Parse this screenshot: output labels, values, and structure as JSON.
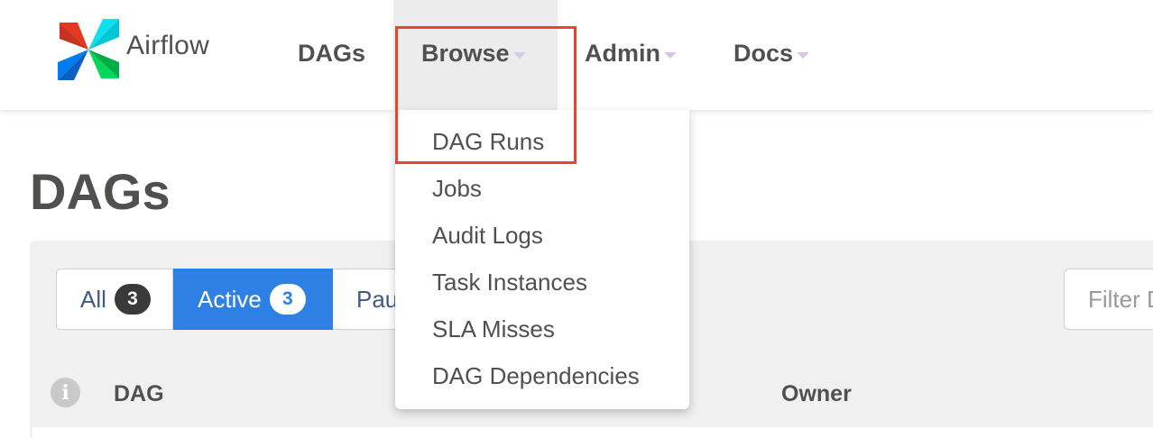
{
  "app": {
    "brand_name": "Airflow",
    "logo_colors": [
      "#e43921",
      "#00ad46",
      "#017cee",
      "#11e1ee",
      "#04d659",
      "#00c7d4"
    ]
  },
  "navbar": {
    "items": [
      {
        "label": "DAGs",
        "has_caret": false
      },
      {
        "label": "Browse",
        "has_caret": true,
        "active": true
      },
      {
        "label": "Admin",
        "has_caret": true
      },
      {
        "label": "Docs",
        "has_caret": true
      }
    ]
  },
  "browse_menu": {
    "items": [
      {
        "label": "DAG Runs",
        "highlighted": true
      },
      {
        "label": "Jobs"
      },
      {
        "label": "Audit Logs"
      },
      {
        "label": "Task Instances"
      },
      {
        "label": "SLA Misses"
      },
      {
        "label": "DAG Dependencies"
      }
    ]
  },
  "page": {
    "title": "DAGs"
  },
  "filters": {
    "all": {
      "label": "All",
      "count": "3"
    },
    "active": {
      "label": "Active",
      "count": "3",
      "selected": true
    },
    "paused": {
      "label": "Pau"
    }
  },
  "search": {
    "placeholder": "Filter D"
  },
  "table": {
    "headers": {
      "dag": "DAG",
      "owner": "Owner"
    }
  },
  "colors": {
    "highlight_box": "#e8452d",
    "active_filter": "#2f80e4",
    "text": "#51504f",
    "caret": "#d8c7e0"
  },
  "icons": {
    "info": "info-icon",
    "caret": "caret-down-icon",
    "logo": "airflow-pinwheel-logo"
  }
}
